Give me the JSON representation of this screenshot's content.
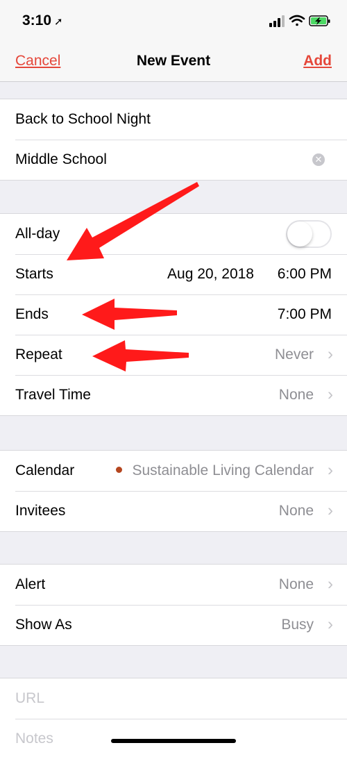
{
  "status_bar": {
    "time": "3:10",
    "location_icon": "location-arrow-icon",
    "signal_icon": "cellular-signal-icon",
    "wifi_icon": "wifi-icon",
    "battery_icon": "battery-charging-icon",
    "battery_color": "#4cd964"
  },
  "nav": {
    "cancel_label": "Cancel",
    "title": "New Event",
    "add_label": "Add",
    "accent_color": "#e5473a"
  },
  "event": {
    "title_value": "Back to School Night",
    "location_value": "Middle School"
  },
  "timing": {
    "allday_label": "All-day",
    "allday_on": false,
    "starts_label": "Starts",
    "starts_date": "Aug 20, 2018",
    "starts_time": "6:00 PM",
    "ends_label": "Ends",
    "ends_time": "7:00 PM",
    "repeat_label": "Repeat",
    "repeat_value": "Never",
    "travel_label": "Travel Time",
    "travel_value": "None"
  },
  "calendar": {
    "calendar_label": "Calendar",
    "calendar_value": "Sustainable Living Calendar",
    "calendar_color": "#b5461f",
    "invitees_label": "Invitees",
    "invitees_value": "None"
  },
  "alerts": {
    "alert_label": "Alert",
    "alert_value": "None",
    "showas_label": "Show As",
    "showas_value": "Busy"
  },
  "notes": {
    "url_placeholder": "URL",
    "notes_placeholder": "Notes"
  },
  "annotation_color": "#ff1a1a"
}
